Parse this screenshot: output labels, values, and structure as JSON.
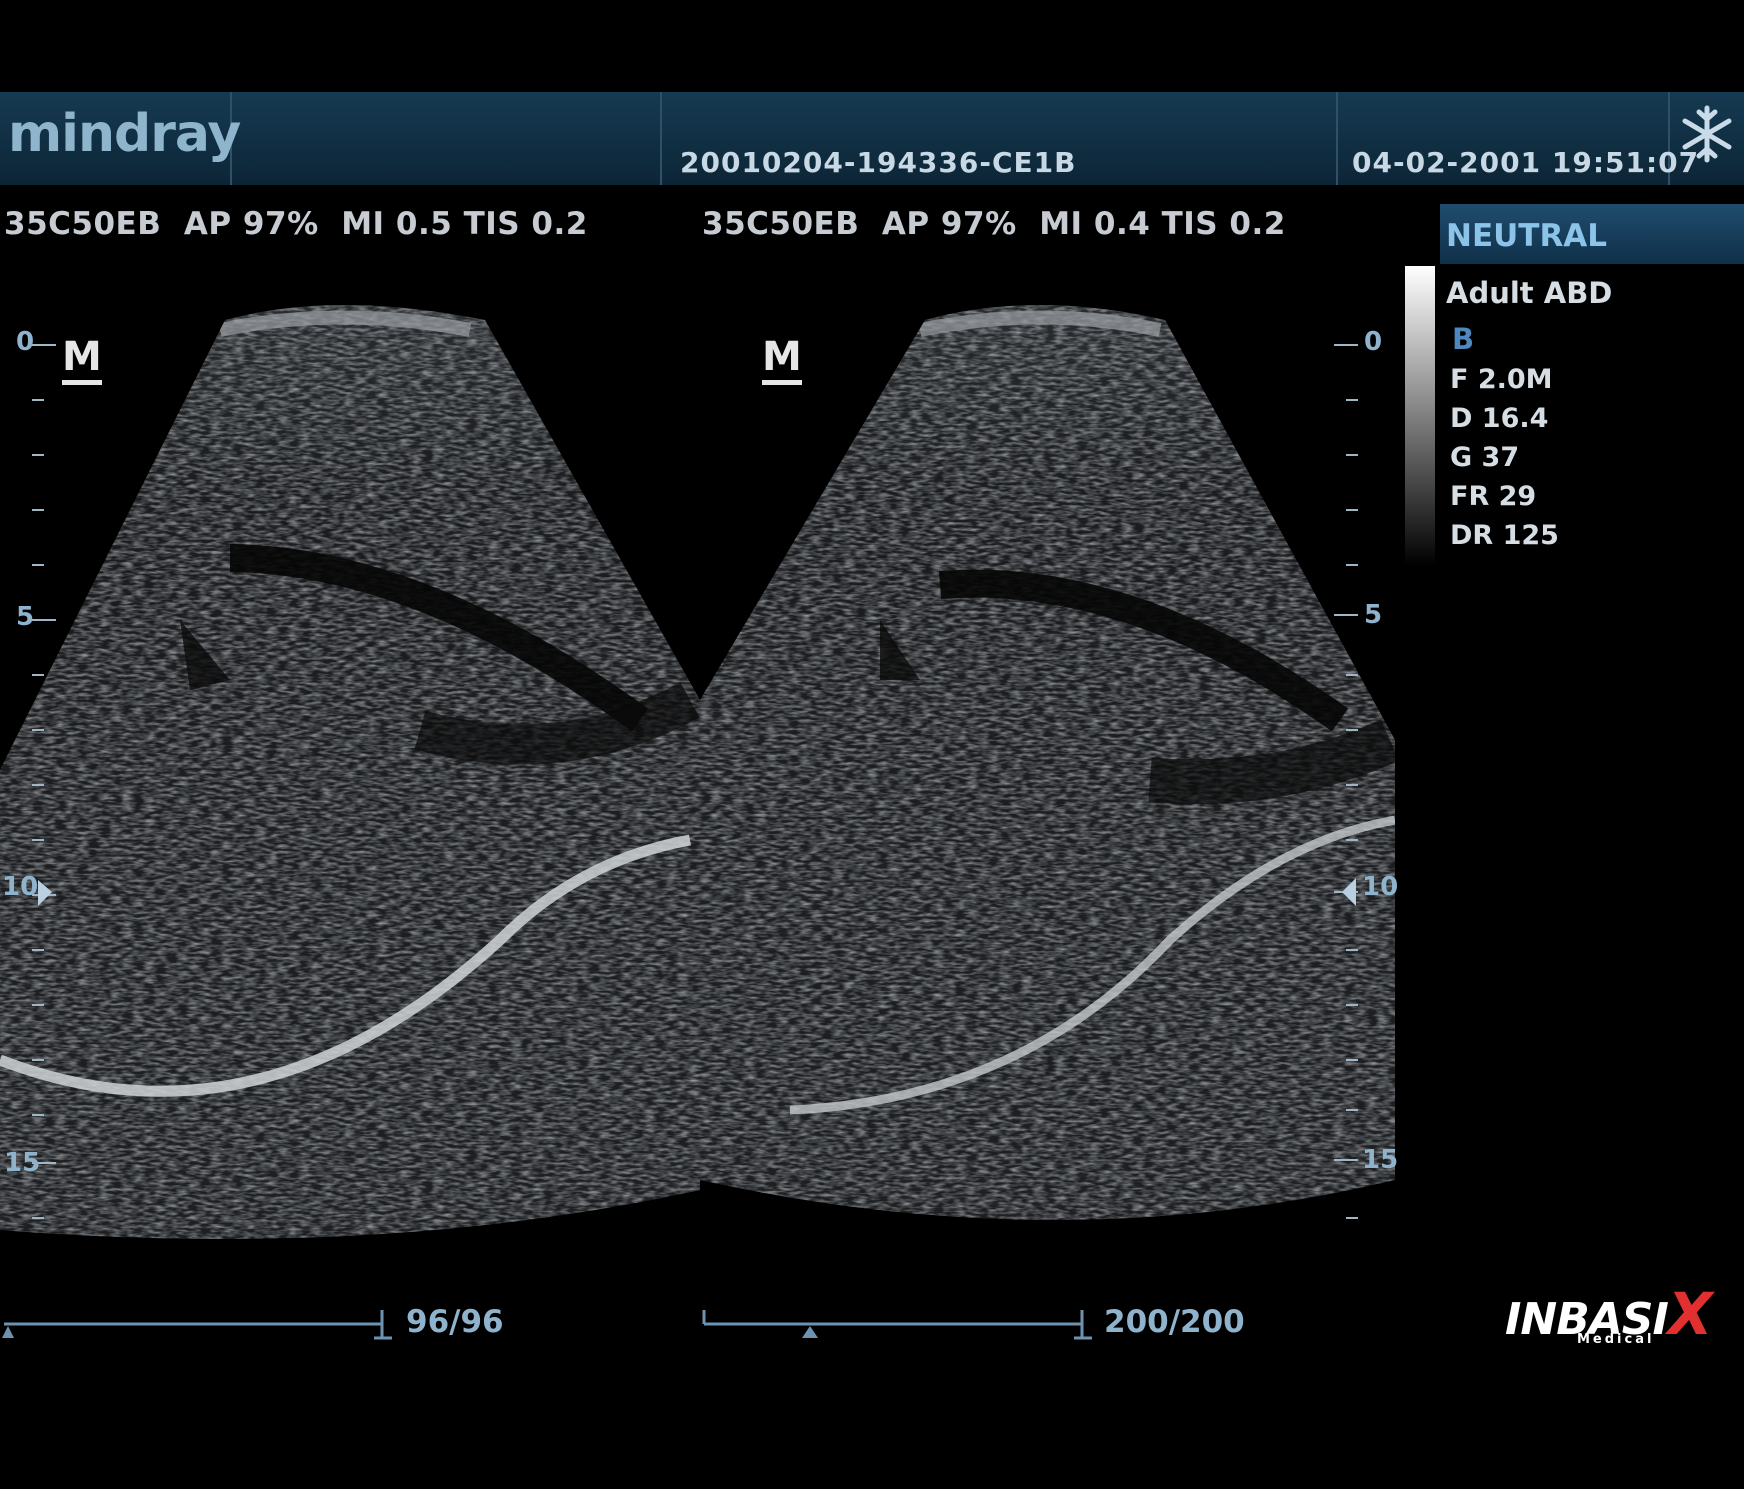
{
  "header": {
    "brand": "mindray",
    "study_id": "20010204-194336-CE1B",
    "datetime": "04-02-2001 19:51:07",
    "freeze_icon": "snowflake-icon"
  },
  "left_image": {
    "info": "35C50EB  AP 97%  MI 0.5 TIS 0.2",
    "orientation_mark": "M",
    "depth_labels": [
      "0",
      "5",
      "10",
      "15"
    ],
    "cine_counter": "96/96"
  },
  "right_image": {
    "info": "35C50EB  AP 97%  MI 0.4 TIS 0.2",
    "orientation_mark": "M",
    "depth_labels": [
      "0",
      "5",
      "10",
      "15"
    ],
    "cine_counter": "200/200"
  },
  "side_panel": {
    "mode_title": "NEUTRAL",
    "preset": "Adult ABD",
    "imaging_mode": "B",
    "params": [
      "F 2.0M",
      "D 16.4",
      "G 37",
      "FR 29",
      "DR 125"
    ]
  },
  "watermark": {
    "name_part": "INBASI",
    "x_part": "X",
    "sub": "Medical"
  },
  "colors": {
    "header_bg": "#0d2738",
    "accent_blue": "#8fb3cc",
    "neutral_text": "#8cc3e8",
    "watermark_red": "#e23030"
  }
}
